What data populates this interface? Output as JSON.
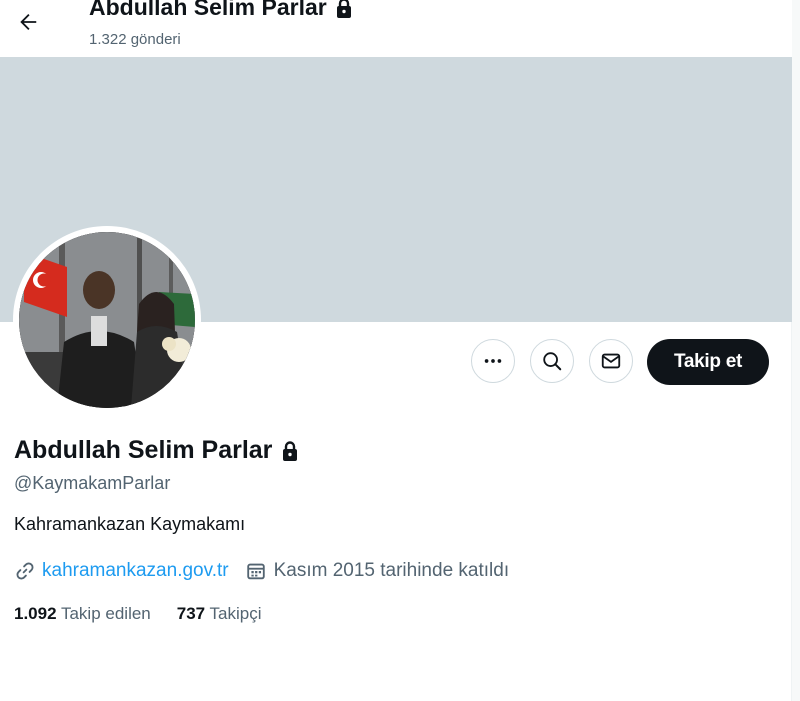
{
  "header": {
    "title": "Abdullah Selim Parlar",
    "post_count": "1.322 gönderi",
    "back_icon": "arrow-left-icon",
    "lock_icon": "lock-icon"
  },
  "profile": {
    "name": "Abdullah Selim Parlar",
    "handle": "@KaymakamParlar",
    "bio": "Kahramankazan Kaymakamı",
    "website": "kahramankazan.gov.tr",
    "joined": "Kasım 2015 tarihinde katıldı",
    "following_count": "1.092",
    "following_label": "Takip edilen",
    "followers_count": "737",
    "followers_label": "Takipçi"
  },
  "actions": {
    "follow_label": "Takip et",
    "more_icon": "more-horizontal-icon",
    "search_icon": "search-icon",
    "message_icon": "mail-icon"
  },
  "colors": {
    "banner": "#cfd9de",
    "link": "#1d9bf0",
    "secondary_text": "#536471",
    "primary_text": "#0f1419",
    "follow_button": "#0f1419"
  }
}
